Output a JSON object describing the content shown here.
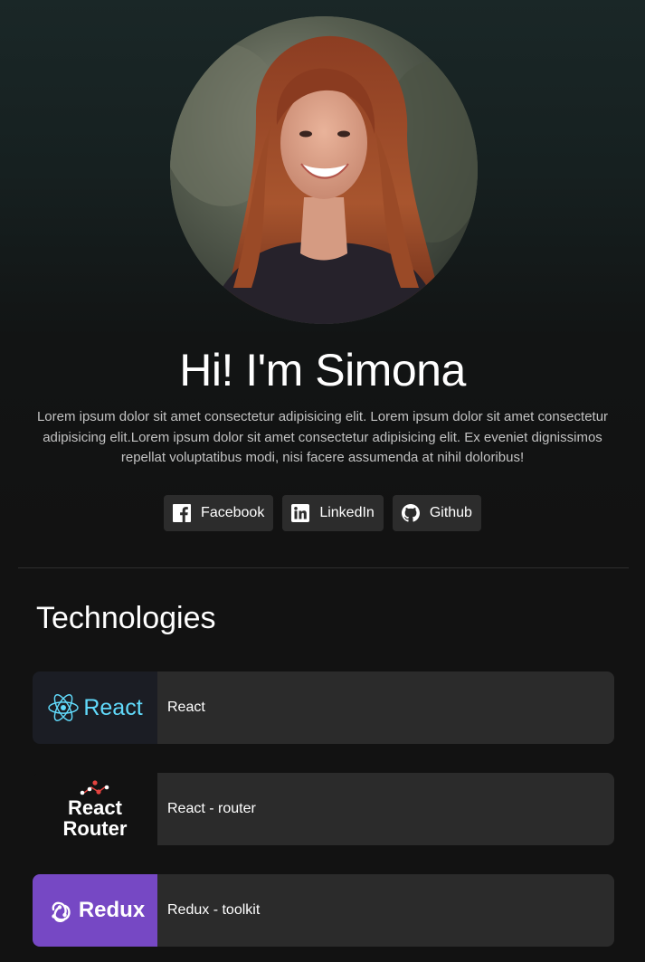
{
  "profile": {
    "avatar_alt": "portrait-photo",
    "title": "Hi! I'm Simona",
    "bio": "Lorem ipsum dolor sit amet consectetur adipisicing elit. Lorem ipsum dolor sit amet consectetur adipisicing elit.Lorem ipsum dolor sit amet consectetur adipisicing elit. Ex eveniet dignissimos repellat voluptatibus modi, nisi facere assumenda at nihil doloribus!"
  },
  "socials": [
    {
      "label": "Facebook",
      "icon": "facebook-icon"
    },
    {
      "label": "LinkedIn",
      "icon": "linkedin-icon"
    },
    {
      "label": "Github",
      "icon": "github-icon"
    }
  ],
  "technologies": {
    "heading": "Technologies",
    "items": [
      {
        "logo_text": "React",
        "label": "React",
        "logo_bg": "#1b1d24",
        "logo_color": "#61dafb"
      },
      {
        "logo_text_line1": "React",
        "logo_text_line2": "Router",
        "label": "React - router",
        "logo_bg": "#121212",
        "accent": "#e4433f"
      },
      {
        "logo_text": "Redux",
        "label": "Redux - toolkit",
        "logo_bg": "#7648c4"
      }
    ]
  },
  "colors": {
    "background": "#121212",
    "card": "#2b2b2b",
    "button": "#2c2c2c",
    "text": "#ffffff",
    "muted_text": "#c2c2c2"
  }
}
